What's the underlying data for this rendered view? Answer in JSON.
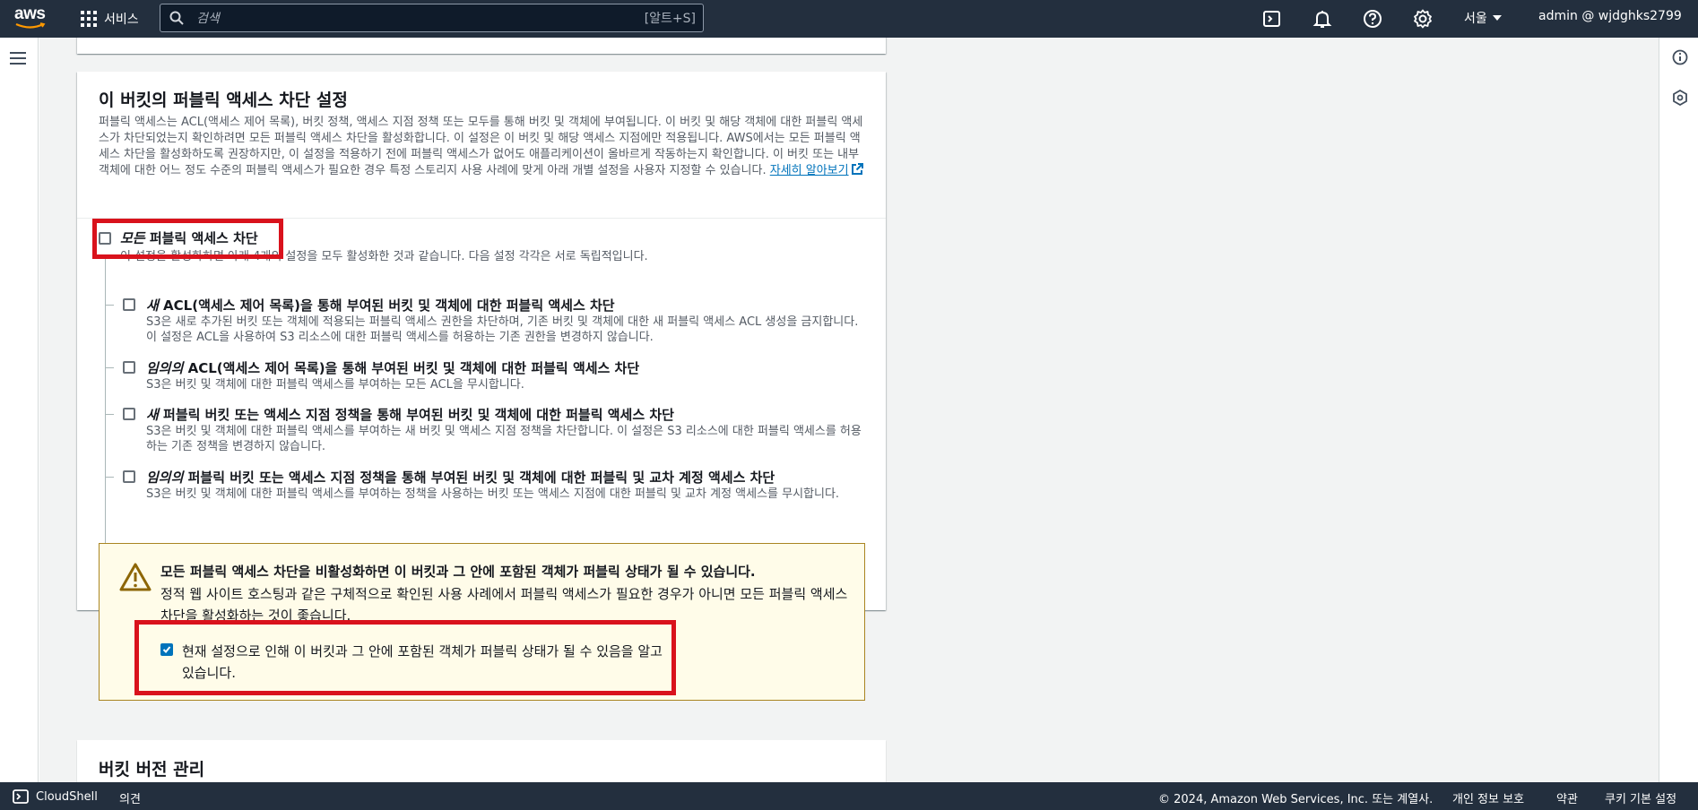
{
  "topnav": {
    "logo_text": "aws",
    "services_label": "서비스",
    "search_placeholder": "검색",
    "search_shortcut": "[알트+S]",
    "region": "서울",
    "account": "admin @ wjdghks2799"
  },
  "card": {
    "title": "이 버킷의 퍼블릭 액세스 차단 설정",
    "description": "퍼블릭 액세스는 ACL(액세스 제어 목록), 버킷 정책, 액세스 지점 정책 또는 모두를 통해 버킷 및 객체에 부여됩니다. 이 버킷 및 해당 객체에 대한 퍼블릭 액세스가 차단되었는지 확인하려면 모든 퍼블릭 액세스 차단을 활성화합니다. 이 설정은 이 버킷 및 해당 액세스 지점에만 적용됩니다. AWS에서는 모든 퍼블릭 액세스 차단을 활성화하도록 권장하지만, 이 설정을 적용하기 전에 퍼블릭 액세스가 없어도 애플리케이션이 올바르게 작동하는지 확인합니다. 이 버킷 또는 내부 객체에 대한 어느 정도 수준의 퍼블릭 액세스가 필요한 경우 특정 스토리지 사용 사례에 맞게 아래 개별 설정을 사용자 지정할 수 있습니다.",
    "learn_more": "자세히 알아보기",
    "master": {
      "label_italic": "모든",
      "label_rest": " 퍼블릭 액세스 차단",
      "checked": false,
      "description": "이 설정을 활성화하면 아래 4개의 설정을 모두 활성화한 것과 같습니다. 다음 설정 각각은 서로 독립적입니다."
    },
    "options": [
      {
        "label_italic": "새",
        "label_rest": " ACL(액세스 제어 목록)을 통해 부여된 버킷 및 객체에 대한 퍼블릭 액세스 차단",
        "description": "S3은 새로 추가된 버킷 또는 객체에 적용되는 퍼블릭 액세스 권한을 차단하며, 기존 버킷 및 객체에 대한 새 퍼블릭 액세스 ACL 생성을 금지합니다. 이 설정은 ACL을 사용하여 S3 리소스에 대한 퍼블릭 액세스를 허용하는 기존 권한을 변경하지 않습니다.",
        "checked": false
      },
      {
        "label_italic": "임의의",
        "label_rest": " ACL(액세스 제어 목록)을 통해 부여된 버킷 및 객체에 대한 퍼블릭 액세스 차단",
        "description": "S3은 버킷 및 객체에 대한 퍼블릭 액세스를 부여하는 모든 ACL을 무시합니다.",
        "checked": false
      },
      {
        "label_italic": "새",
        "label_rest": " 퍼블릭 버킷 또는 액세스 지점 정책을 통해 부여된 버킷 및 객체에 대한 퍼블릭 액세스 차단",
        "description": "S3은 버킷 및 객체에 대한 퍼블릭 액세스를 부여하는 새 버킷 및 액세스 지점 정책을 차단합니다. 이 설정은 S3 리소스에 대한 퍼블릭 액세스를 허용하는 기존 정책을 변경하지 않습니다.",
        "checked": false
      },
      {
        "label_italic": "임의의",
        "label_rest": " 퍼블릭 버킷 또는 액세스 지점 정책을 통해 부여된 버킷 및 객체에 대한 퍼블릭 및 교차 계정 액세스 차단",
        "description": "S3은 버킷 및 객체에 대한 퍼블릭 액세스를 부여하는 정책을 사용하는 버킷 또는 액세스 지점에 대한 퍼블릭 및 교차 계정 액세스를 무시합니다.",
        "checked": false
      }
    ],
    "warning": {
      "title": "모든 퍼블릭 액세스 차단을 비활성화하면 이 버킷과 그 안에 포함된 객체가 퍼블릭 상태가 될 수 있습니다.",
      "description": "정적 웹 사이트 호스팅과 같은 구체적으로 확인된 사용 사례에서 퍼블릭 액세스가 필요한 경우가 아니면 모든 퍼블릭 액세스 차단을 활성화하는 것이 좋습니다.",
      "ack_label": "현재 설정으로 인해 이 버킷과 그 안에 포함된 객체가 퍼블릭 상태가 될 수 있음을 알고 있습니다.",
      "ack_checked": true
    }
  },
  "next_section": {
    "title": "버킷 버전 관리"
  },
  "footer": {
    "cloudshell": "CloudShell",
    "feedback": "의견",
    "copyright": "© 2024, Amazon Web Services, Inc. 또는 계열사.",
    "privacy": "개인 정보 보호",
    "terms": "약관",
    "cookies": "쿠키 기본 설정"
  },
  "colors": {
    "nav_bg": "#232f3e",
    "link": "#0073bb",
    "checkbox_checked": "#0073bb",
    "warning_bg": "#fffce9",
    "warning_border": "#aa8521",
    "highlight_red": "#d9121c"
  },
  "icons": [
    "aws-logo",
    "grid-icon",
    "search-icon",
    "cloudshell-icon",
    "bell-icon",
    "help-icon",
    "gear-icon",
    "caret-down-icon",
    "hamburger-icon",
    "info-icon",
    "hexagon-icon",
    "external-link-icon",
    "warning-icon",
    "checkmark-icon"
  ]
}
